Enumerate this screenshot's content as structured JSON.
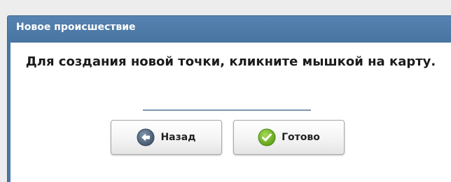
{
  "dialog": {
    "title": "Новое происшествие",
    "message": "Для создания новой точки, кликните мышкой на карту.",
    "buttons": {
      "back": {
        "label": "Назад",
        "icon": "arrow-left-circle-icon",
        "color": "#4a5e73"
      },
      "done": {
        "label": "Готово",
        "icon": "checkmark-circle-icon",
        "color": "#6cb31f"
      }
    }
  },
  "colors": {
    "header_bg": "#4b77a4",
    "separator": "#7e97b0"
  }
}
